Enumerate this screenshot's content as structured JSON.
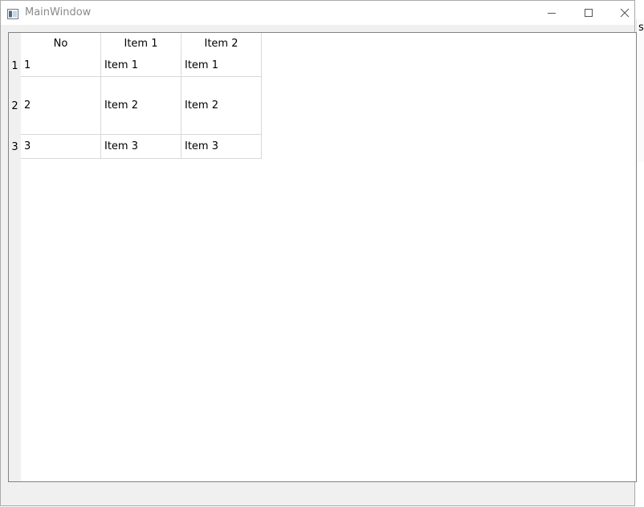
{
  "window": {
    "title": "MainWindow"
  },
  "table": {
    "columns": [
      "No",
      "Item 1",
      "Item 2"
    ],
    "row_headers": [
      "1",
      "2",
      "3"
    ],
    "rows": [
      [
        "1",
        "Item 1",
        "Item 1"
      ],
      [
        "2",
        "Item 2",
        "Item 2"
      ],
      [
        "3",
        "Item 3",
        "Item 3"
      ]
    ]
  },
  "background_window": {
    "visible_text": "s"
  },
  "icons": {
    "app": "app-window-icon",
    "minimize": "minimize-icon",
    "maximize": "maximize-icon",
    "close": "close-icon"
  }
}
